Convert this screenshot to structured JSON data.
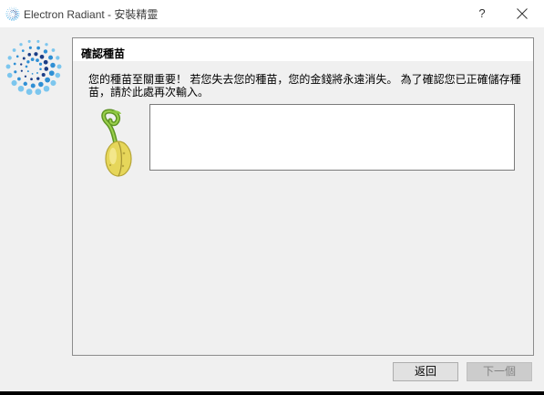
{
  "window": {
    "title": "Electron Radiant  -  安裝精靈",
    "help_label": "?",
    "close_icon": "close-icon",
    "app_icon": "electron-radiant-logo-icon"
  },
  "panel": {
    "title": "確認種苗",
    "instructions": "您的種苗至關重要！ 若您失去您的種苗，您的金錢將永遠消失。 為了確認您已正確儲存種苗，請於此處再次輸入。",
    "seed_icon": "seed-sprout-icon",
    "seed_input_value": ""
  },
  "buttons": {
    "back_label": "返回",
    "next_label": "下一個",
    "next_enabled": false
  },
  "colors": {
    "logo_dark": "#1a3d86",
    "logo_mid": "#2f8fd4",
    "logo_light": "#7cc6ee",
    "seed_yellow": "#e6d65a",
    "sprout_green": "#6aa329"
  }
}
